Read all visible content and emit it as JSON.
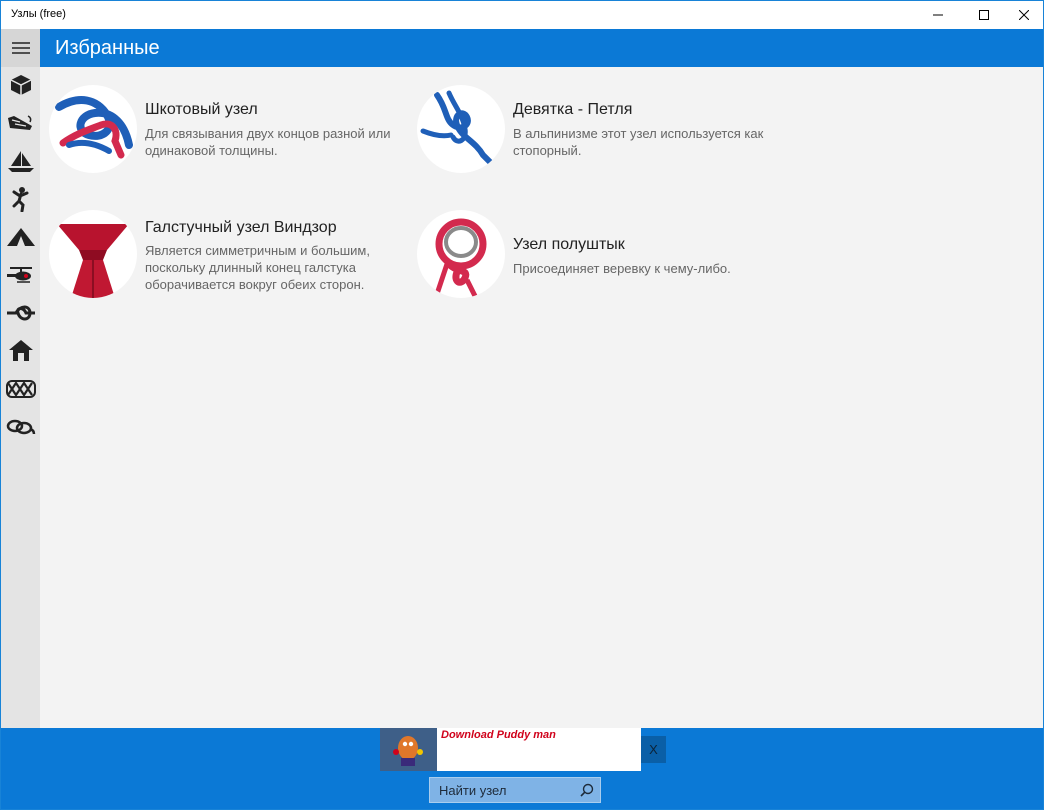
{
  "window": {
    "title": "Узлы (free)"
  },
  "header": {
    "title": "Избранные"
  },
  "sidebar": {
    "icons": [
      "box-icon",
      "boat-hull-icon",
      "sailboat-icon",
      "climber-icon",
      "tent-icon",
      "helicopter-icon",
      "rope-loop-icon",
      "house-icon",
      "celtic-knot-icon",
      "rope-coil-icon"
    ]
  },
  "knots": [
    {
      "title": "Шкотовый узел",
      "description": "Для связывания двух концов разной или одинаковой толщины."
    },
    {
      "title": "Девятка - Петля",
      "description": "В альпинизме этот узел используется как стопорный."
    },
    {
      "title": "Галстучный узел Виндзор",
      "description": "Является симметричным и большим, поскольку длинный конец галстука оборачивается вокруг обеих сторон."
    },
    {
      "title": "Узел полуштык",
      "description": "Присоединяет веревку к чему-либо."
    }
  ],
  "ad": {
    "text": "Download Puddy man",
    "close_label": "X"
  },
  "search": {
    "placeholder": "Найти узел"
  },
  "colors": {
    "accent": "#0b79d6",
    "sidebar": "#e4e4e4",
    "background": "#f3f3f3",
    "ad_text": "#d0021b"
  }
}
